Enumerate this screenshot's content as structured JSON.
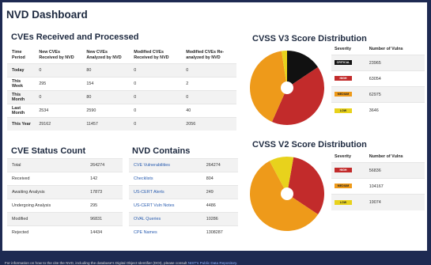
{
  "page_title": "NVD Dashboard",
  "cves": {
    "title": "CVEs Received and Processed",
    "headers": [
      "Time Period",
      "New CVEs Received by NVD",
      "New CVEs Analyzed by NVD",
      "Modified CVEs Received by NVD",
      "Modified CVEs Re-analyzed by NVD"
    ],
    "rows": [
      [
        "Today",
        "0",
        "80",
        "0",
        "0"
      ],
      [
        "This Week",
        "295",
        "154",
        "0",
        "2"
      ],
      [
        "This Month",
        "0",
        "80",
        "0",
        "0"
      ],
      [
        "Last Month",
        "2534",
        "2590",
        "0",
        "40"
      ],
      [
        "This Year",
        "29162",
        "11457",
        "0",
        "2056"
      ]
    ]
  },
  "status": {
    "title": "CVE Status Count",
    "rows": [
      [
        "Total",
        "264274"
      ],
      [
        "Received",
        "142"
      ],
      [
        "Awaiting Analysis",
        "17873"
      ],
      [
        "Undergoing Analysis",
        "295"
      ],
      [
        "Modified",
        "96831"
      ],
      [
        "Rejected",
        "14434"
      ]
    ]
  },
  "contains": {
    "title": "NVD Contains",
    "rows": [
      [
        "CVE Vulnerabilities",
        "264274"
      ],
      [
        "Checklists",
        "804"
      ],
      [
        "US-CERT Alerts",
        "249"
      ],
      [
        "US-CERT Vuln Notes",
        "4486"
      ],
      [
        "OVAL Queries",
        "10286"
      ],
      [
        "CPE Names",
        "1308287"
      ]
    ]
  },
  "v3": {
    "title": "CVSS V3 Score Distribution",
    "col_severity": "Severity",
    "col_count": "Number of Vulns",
    "rows": [
      {
        "label": "CRITICAL",
        "value": "23965",
        "color": "#111111",
        "text": "#ffffff"
      },
      {
        "label": "HIGH",
        "value": "63054",
        "color": "#c22b2b",
        "text": "#ffffff"
      },
      {
        "label": "MEDIUM",
        "value": "62975",
        "color": "#ee9a1a",
        "text": "#222222"
      },
      {
        "label": "LOW",
        "value": "3646",
        "color": "#e8d21c",
        "text": "#222222"
      }
    ]
  },
  "v2": {
    "title": "CVSS V2 Score Distribution",
    "col_severity": "Severity",
    "col_count": "Number of Vulns",
    "rows": [
      {
        "label": "HIGH",
        "value": "56836",
        "color": "#c22b2b",
        "text": "#ffffff"
      },
      {
        "label": "MEDIUM",
        "value": "104167",
        "color": "#ee9a1a",
        "text": "#222222"
      },
      {
        "label": "LOW",
        "value": "19074",
        "color": "#e8d21c",
        "text": "#222222"
      }
    ]
  },
  "footer": {
    "text": "For information on how to the cite the NVD, including the database's Digital Object Identifier (DOI), please consult ",
    "link": "NIST's Public Data Repository."
  }
}
